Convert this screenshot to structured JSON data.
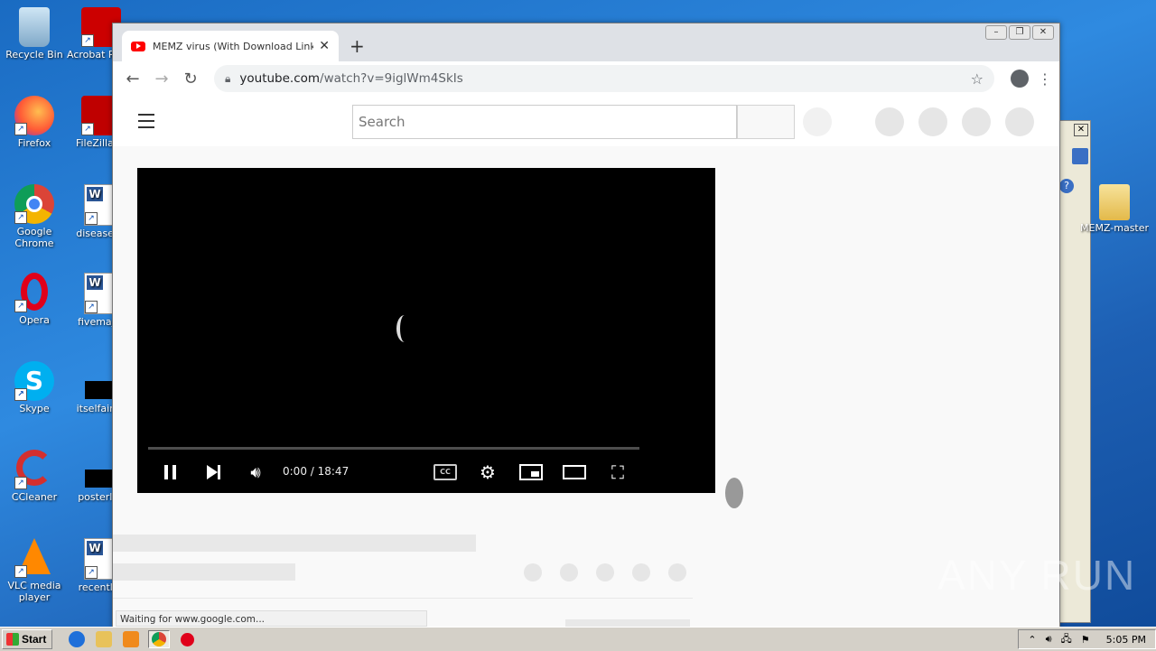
{
  "desktop": {
    "icons": [
      {
        "label": "Recycle Bin",
        "icon": "recycle-bin-icon"
      },
      {
        "label": "Acrobat Reader",
        "icon": "acrobat-icon"
      },
      {
        "label": "Firefox",
        "icon": "firefox-icon"
      },
      {
        "label": "FileZilla Cl",
        "icon": "filezilla-icon"
      },
      {
        "label": "Google Chrome",
        "icon": "chrome-icon"
      },
      {
        "label": "diseasega",
        "icon": "word-doc-icon"
      },
      {
        "label": "Opera",
        "icon": "opera-icon"
      },
      {
        "label": "fivemajor",
        "icon": "word-doc-icon"
      },
      {
        "label": "Skype",
        "icon": "skype-icon"
      },
      {
        "label": "itselfairpo",
        "icon": "black-file-icon"
      },
      {
        "label": "CCleaner",
        "icon": "ccleaner-icon"
      },
      {
        "label": "posterlea",
        "icon": "black-file-icon"
      },
      {
        "label": "VLC media player",
        "icon": "vlc-icon"
      },
      {
        "label": "recentlyc",
        "icon": "word-doc-icon"
      },
      {
        "label": "MEMZ-master",
        "icon": "folder-icon"
      }
    ]
  },
  "browser": {
    "tab_title": "MEMZ virus (With Download Link) - Y",
    "url_host": "youtube.com",
    "url_path": "/watch?v=9iglWm4SkIs",
    "status_text": "Waiting for www.google.com..."
  },
  "youtube": {
    "search_placeholder": "Search",
    "time_display": "0:00 / 18:47",
    "playback_progress": 0,
    "cc_label": "CC"
  },
  "taskbar": {
    "start_label": "Start",
    "clock": "5:05 PM"
  },
  "watermark": "ANY RUN"
}
